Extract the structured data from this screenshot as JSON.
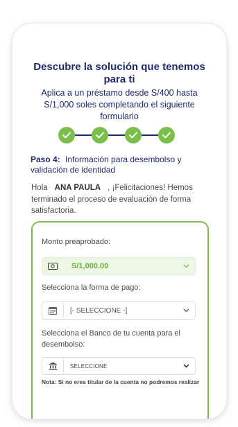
{
  "header": {
    "title": "Descubre la solución que tenemos para ti",
    "subtitle": "Aplica a un préstamo desde S/400 hasta S/1,000 soles completando el siguiente formulario"
  },
  "stepper": {
    "total_steps": 4,
    "completed_steps": 4,
    "steps": [
      "check-icon",
      "check-icon",
      "check-icon",
      "check-icon"
    ],
    "dot_color": "#7bc04a",
    "line_color": "#1d2a6b"
  },
  "step_info": {
    "label": "Paso 4:",
    "text": "Información para desembolso y validación de identidad"
  },
  "greeting": {
    "hello": "Hola",
    "name": "ANA PAULA",
    "message": ", ¡Felicitaciones! Hemos terminado el proceso de evaluación de forma satisfactoria."
  },
  "form": {
    "amount": {
      "label": "Monto preaprobado:",
      "value": "S/1,000.00",
      "icon": "money-icon"
    },
    "payment_method": {
      "label": "Selecciona la forma de pago:",
      "value": "[- SELECCIONE -]",
      "icon": "calendar-icon"
    },
    "bank": {
      "label": "Selecciona el Banco de tu cuenta para el desembolso:",
      "value": "SELECCIONE",
      "icon": "bank-icon"
    },
    "note": "Nota: Si no eres titular de la cuenta no podremos realizar"
  },
  "colors": {
    "brand_navy": "#1d2a6b",
    "accent_green": "#7bc04a",
    "amount_bg": "#eef7e6"
  }
}
